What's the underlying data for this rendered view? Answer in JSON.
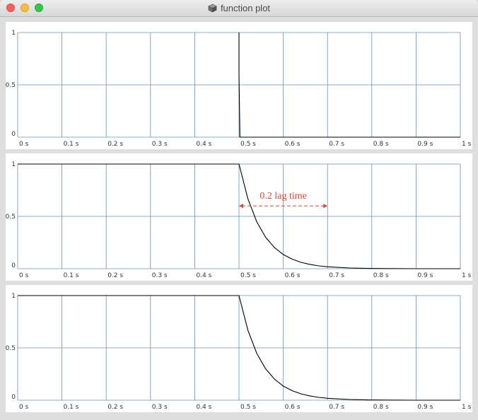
{
  "window": {
    "title": "function plot",
    "icon": "cube-icon"
  },
  "colors": {
    "grid": "#6d8fb0",
    "curve": "#000000",
    "annotation": "#e8402a"
  },
  "chart_data": [
    {
      "type": "line",
      "xlim": [
        0,
        1
      ],
      "ylim": [
        0,
        1
      ],
      "x_ticks": [
        "0 s",
        "0.1 s",
        "0.2 s",
        "0.3 s",
        "0.4 s",
        "0.5 s",
        "0.6 s",
        "0.7 s",
        "0.8 s",
        "0.9 s",
        "1 s"
      ],
      "y_ticks": [
        "0",
        "0.5",
        "1"
      ],
      "grid": true,
      "series": [
        {
          "x": [
            0.5,
            0.5,
            0.502,
            1.0
          ],
          "values": [
            1.0,
            0.6,
            0.0,
            0.0
          ]
        }
      ]
    },
    {
      "type": "line",
      "xlim": [
        0,
        1
      ],
      "ylim": [
        0,
        1
      ],
      "x_ticks": [
        "0 s",
        "0.1 s",
        "0.2 s",
        "0.3 s",
        "0.4 s",
        "0.5 s",
        "0.6 s",
        "0.7 s",
        "0.8 s",
        "0.9 s",
        "1 s"
      ],
      "y_ticks": [
        "0",
        "0.5",
        "1"
      ],
      "grid": true,
      "series": [
        {
          "x": [
            0,
            0.5,
            0.52,
            0.54,
            0.56,
            0.58,
            0.6,
            0.62,
            0.64,
            0.66,
            0.68,
            0.7,
            0.75,
            0.8,
            0.9,
            1.0
          ],
          "values": [
            1.0,
            1.0,
            0.67,
            0.449,
            0.301,
            0.202,
            0.135,
            0.091,
            0.061,
            0.041,
            0.027,
            0.018,
            0.007,
            0.002,
            0.0,
            0.0
          ]
        }
      ],
      "annotation": {
        "text": "0.2 lag time",
        "x_start": 0.5,
        "x_end": 0.7,
        "y": 0.6
      }
    },
    {
      "type": "line",
      "xlim": [
        0,
        1
      ],
      "ylim": [
        0,
        1
      ],
      "x_ticks": [
        "0 s",
        "0.1 s",
        "0.2 s",
        "0.3 s",
        "0.4 s",
        "0.5 s",
        "0.6 s",
        "0.7 s",
        "0.8 s",
        "0.9 s",
        "1 s"
      ],
      "y_ticks": [
        "0",
        "0.5",
        "1"
      ],
      "grid": true,
      "series": [
        {
          "x": [
            0,
            0.5,
            0.52,
            0.54,
            0.56,
            0.58,
            0.6,
            0.62,
            0.64,
            0.66,
            0.68,
            0.7,
            0.75,
            0.8,
            0.9,
            1.0
          ],
          "values": [
            1.0,
            1.0,
            0.67,
            0.449,
            0.301,
            0.202,
            0.135,
            0.091,
            0.061,
            0.041,
            0.027,
            0.018,
            0.007,
            0.002,
            0.0,
            0.0
          ]
        }
      ]
    }
  ]
}
